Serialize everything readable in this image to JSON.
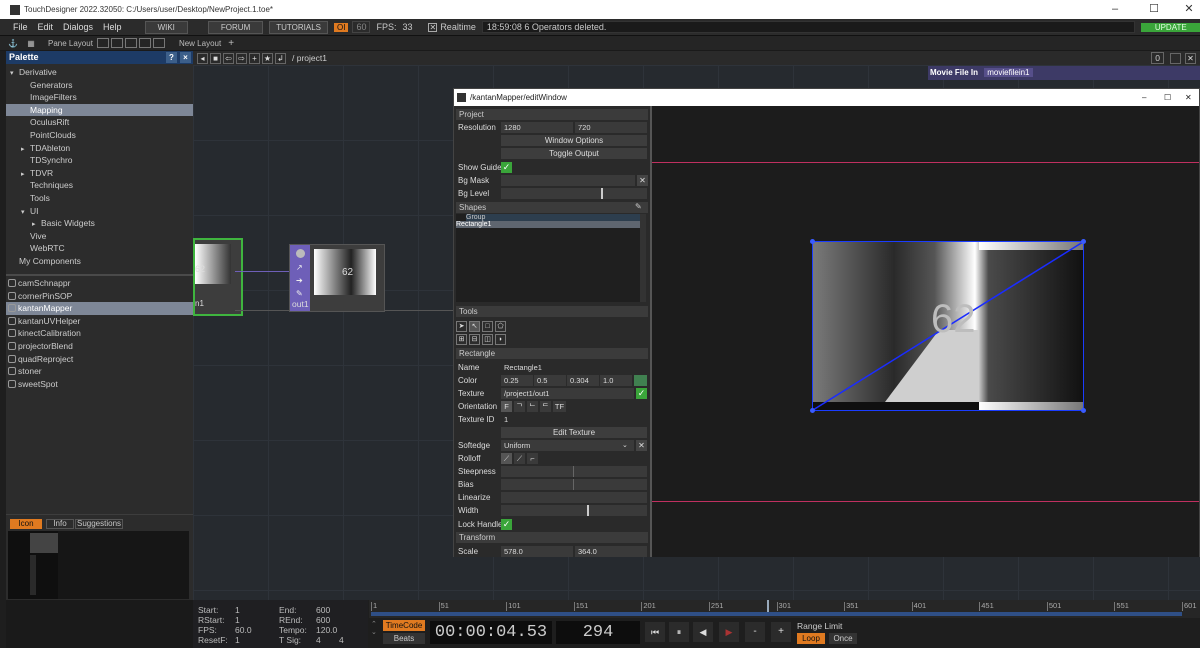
{
  "window": {
    "title": "TouchDesigner 2022.32050: C:/Users/user/Desktop/NewProject.1.toe*",
    "controls": [
      "–",
      "☐",
      "✕"
    ]
  },
  "menu": {
    "items": [
      "File",
      "Edit",
      "Dialogs",
      "Help"
    ],
    "wiki": "WIKI",
    "forum": "FORUM",
    "tutorials": "TUTORIALS",
    "oi": "OI",
    "fps_box": "60",
    "fps_label": "FPS:",
    "fps_value": "33",
    "realtime": "Realtime",
    "status": "18:59:08 6 Operators deleted.",
    "update": "UPDATE"
  },
  "toolbar": {
    "pane_layout": "Pane Layout",
    "new_layout": "New Layout",
    "plus": "+"
  },
  "palette": {
    "title": "Palette",
    "help": "?",
    "close": "×",
    "tree": [
      {
        "label": "Derivative",
        "level": 0,
        "arrow": "▾"
      },
      {
        "label": "Generators",
        "level": 1,
        "arrow": ""
      },
      {
        "label": "ImageFilters",
        "level": 1,
        "arrow": ""
      },
      {
        "label": "Mapping",
        "level": 1,
        "arrow": "",
        "selected": true
      },
      {
        "label": "OculusRift",
        "level": 1,
        "arrow": ""
      },
      {
        "label": "PointClouds",
        "level": 1,
        "arrow": ""
      },
      {
        "label": "TDAbleton",
        "level": 1,
        "arrow": "▸"
      },
      {
        "label": "TDSynchro",
        "level": 1,
        "arrow": ""
      },
      {
        "label": "TDVR",
        "level": 1,
        "arrow": "▸"
      },
      {
        "label": "Techniques",
        "level": 1,
        "arrow": ""
      },
      {
        "label": "Tools",
        "level": 1,
        "arrow": ""
      },
      {
        "label": "UI",
        "level": 1,
        "arrow": "▾"
      },
      {
        "label": "Basic Widgets",
        "level": 2,
        "arrow": "▸"
      },
      {
        "label": "Vive",
        "level": 1,
        "arrow": ""
      },
      {
        "label": "WebRTC",
        "level": 1,
        "arrow": ""
      },
      {
        "label": "My Components",
        "level": 0,
        "arrow": ""
      }
    ],
    "components": [
      {
        "label": "camSchnappr"
      },
      {
        "label": "cornerPinSOP"
      },
      {
        "label": "kantanMapper",
        "selected": true
      },
      {
        "label": "kantanUVHelper"
      },
      {
        "label": "kinectCalibration"
      },
      {
        "label": "projectorBlend"
      },
      {
        "label": "quadReproject"
      },
      {
        "label": "stoner"
      },
      {
        "label": "sweetSpot"
      }
    ],
    "tabs": [
      "Icon",
      "Info",
      "Suggestions"
    ]
  },
  "network": {
    "path": "/ project1",
    "node1_label": "n1",
    "node2_label": "out1",
    "thumb_number": "62",
    "pane_index": "0"
  },
  "movie": {
    "label": "Movie File In",
    "value": "moviefilein1"
  },
  "editwin": {
    "title": "/kantanMapper/editWindow",
    "project": {
      "header": "Project",
      "resolution_label": "Resolution",
      "res_w": "1280",
      "res_h": "720",
      "window_options": "Window Options",
      "toggle_output": "Toggle Output",
      "show_guide": "Show Guide",
      "bg_mask": "Bg Mask",
      "bg_level": "Bg Level",
      "bg_level_value": 0.7
    },
    "shapes": {
      "header": "Shapes",
      "items": [
        "Group",
        "Rectangle1"
      ]
    },
    "tools": {
      "header": "Tools"
    },
    "rect": {
      "header": "Rectangle",
      "name_label": "Name",
      "name": "Rectangle1",
      "color_label": "Color",
      "color": [
        "0.25",
        "0.5",
        "0.304",
        "1.0"
      ],
      "texture_label": "Texture",
      "texture": "/project1/out1",
      "orientation_label": "Orientation",
      "orientation_opts": [
        "F",
        "ᄀ",
        "ᄂ",
        "ᄃ",
        "TF"
      ],
      "texid_label": "Texture ID",
      "texid": "1",
      "edit_texture": "Edit Texture",
      "softedge_label": "Softedge",
      "softedge": "Uniform",
      "rolloff_label": "Rolloff",
      "steepness_label": "Steepness",
      "steepness_value": 0.5,
      "bias_label": "Bias",
      "bias_value": 0.5,
      "linearize_label": "Linearize",
      "width_label": "Width",
      "width_value": 0.6,
      "lock_label": "Lock Handles"
    },
    "transform": {
      "header": "Transform",
      "scale_label": "Scale",
      "scale_x": "578.0",
      "scale_y": "364.0"
    },
    "viewer": {
      "number": "62"
    }
  },
  "timeline": {
    "start_l": "Start:",
    "start": "1",
    "rstart_l": "RStart:",
    "rstart": "1",
    "fps_l": "FPS:",
    "fps": "60.0",
    "resetf_l": "ResetF:",
    "resetf": "1",
    "end_l": "End:",
    "end": "600",
    "rend_l": "REnd:",
    "rend": "600",
    "tempo_l": "Tempo:",
    "tempo": "120.0",
    "tsig_l": "T Sig:",
    "tsig_a": "4",
    "tsig_b": "4",
    "timecode_btn": "TimeCode",
    "beats_btn": "Beats",
    "timecode": "00:00:04.53",
    "frame": "294",
    "range_limit": "Range Limit",
    "loop": "Loop",
    "once": "Once",
    "ticks": [
      "1",
      "51",
      "101",
      "151",
      "201",
      "251",
      "301",
      "351",
      "401",
      "451",
      "501",
      "551",
      "601"
    ],
    "playhead": 294,
    "range_end": 601
  }
}
